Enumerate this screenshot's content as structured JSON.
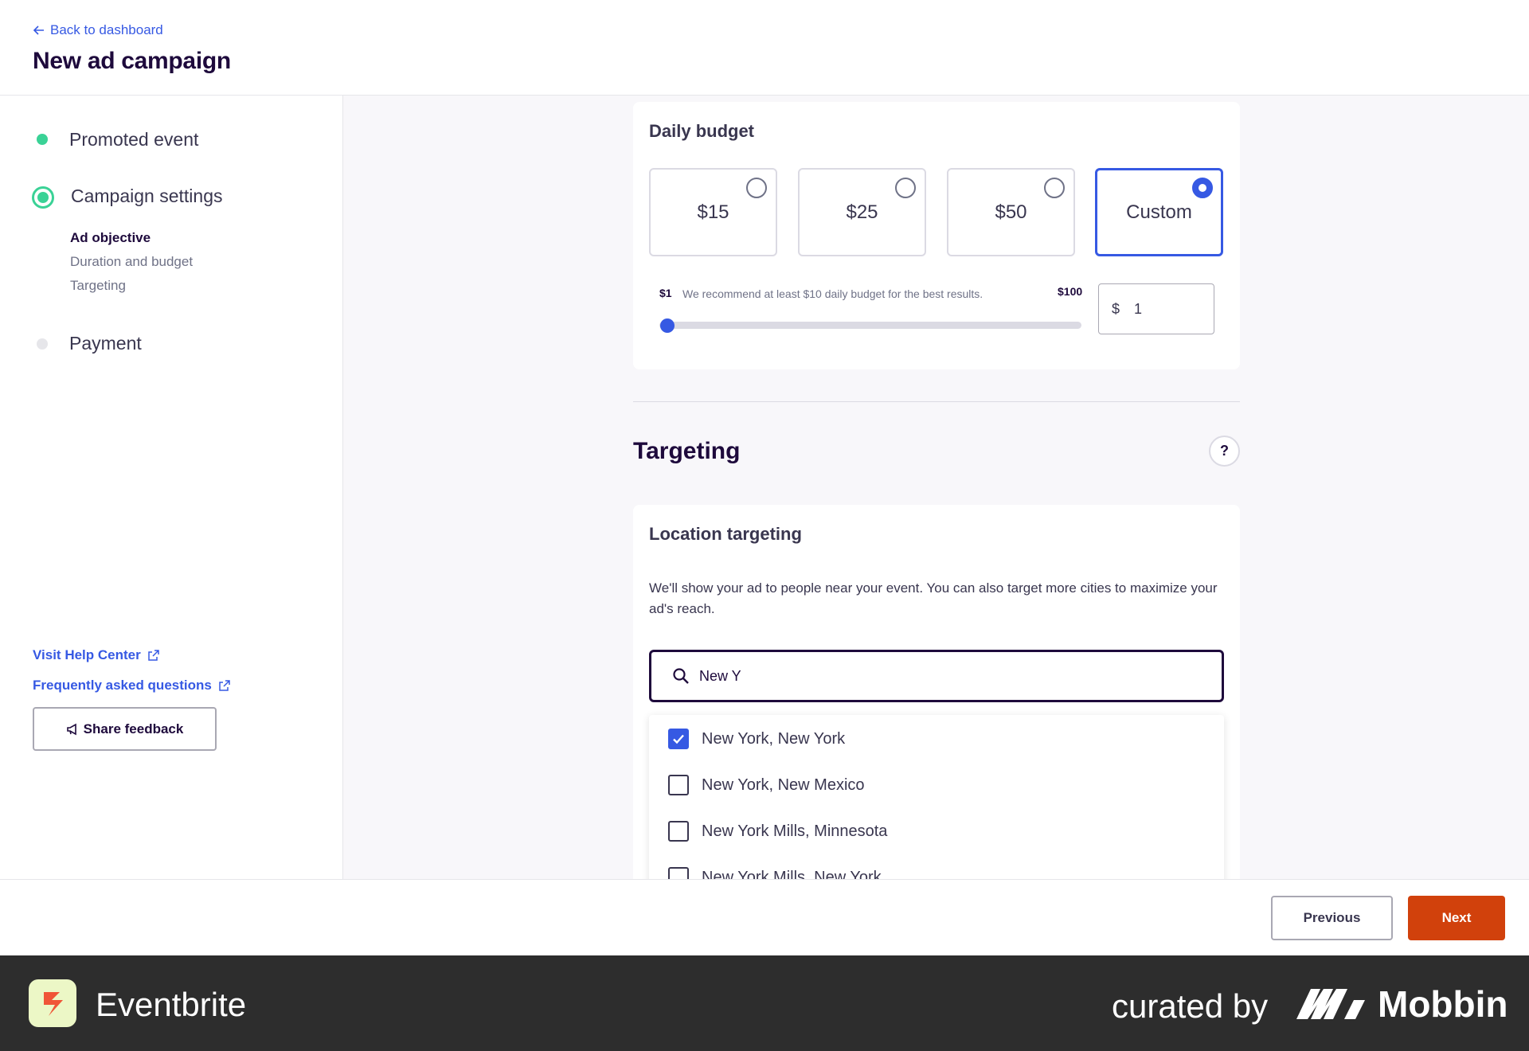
{
  "header": {
    "back_label": "Back to dashboard",
    "title": "New ad campaign"
  },
  "sidebar": {
    "steps": [
      {
        "label": "Promoted event",
        "state": "done",
        "color": "#3ad296"
      },
      {
        "label": "Campaign settings",
        "state": "current",
        "color": "#3ad296"
      },
      {
        "label": "Payment",
        "state": "pending",
        "color": "#e6e6ea"
      }
    ],
    "substeps": [
      {
        "label": "Ad objective",
        "active": true
      },
      {
        "label": "Duration and budget",
        "active": false
      },
      {
        "label": "Targeting",
        "active": false
      }
    ],
    "help_center_label": "Visit Help Center",
    "faq_label": "Frequently asked questions",
    "feedback_label": "Share feedback"
  },
  "budget": {
    "title": "Daily budget",
    "options": [
      {
        "label": "$15",
        "selected": false
      },
      {
        "label": "$25",
        "selected": false
      },
      {
        "label": "$50",
        "selected": false
      },
      {
        "label": "Custom",
        "selected": true
      }
    ],
    "range_min": "$1",
    "range_max": "$100",
    "hint": "We recommend at least $10 daily budget for the best results.",
    "slider_value": 1,
    "currency": "$",
    "amount": "1"
  },
  "targeting": {
    "section_title": "Targeting",
    "help_icon": "?",
    "location_title": "Location targeting",
    "description": "We'll show your ad to people near your event. You can also target more cities to maximize your ad's reach.",
    "search_value": "New Y",
    "results": [
      {
        "label": "New York, New York",
        "checked": true
      },
      {
        "label": "New York, New Mexico",
        "checked": false
      },
      {
        "label": "New York Mills, Minnesota",
        "checked": false
      },
      {
        "label": "New York Mills, New York",
        "checked": false
      }
    ]
  },
  "actions": {
    "previous_label": "Previous",
    "next_label": "Next"
  },
  "branding": {
    "app_name": "Eventbrite",
    "curated_by": "curated by",
    "curator": "Mobbin"
  },
  "colors": {
    "accent": "#3659e3",
    "brand": "#d1410c",
    "success": "#3ad296"
  }
}
